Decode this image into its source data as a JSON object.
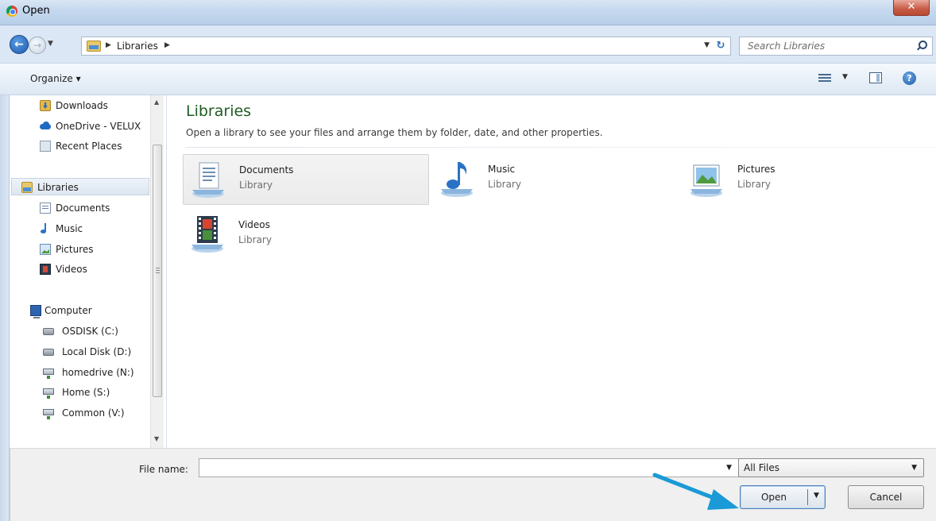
{
  "window": {
    "title": "Open"
  },
  "address": {
    "path_label": "Libraries",
    "search_placeholder": "Search Libraries"
  },
  "toolbar": {
    "organize_label": "Organize ▾"
  },
  "nav": {
    "items": [
      {
        "label": "Downloads",
        "icon": "downloads-icon"
      },
      {
        "label": "OneDrive - VELUX",
        "icon": "onedrive-icon"
      },
      {
        "label": "Recent Places",
        "icon": "recent-places-icon"
      },
      {
        "label": "Libraries",
        "icon": "library-icon",
        "selected": true
      },
      {
        "label": "Documents",
        "icon": "documents-icon"
      },
      {
        "label": "Music",
        "icon": "music-icon"
      },
      {
        "label": "Pictures",
        "icon": "pictures-icon"
      },
      {
        "label": "Videos",
        "icon": "videos-icon"
      },
      {
        "label": "Computer",
        "icon": "computer-icon"
      },
      {
        "label": "OSDISK (C:)",
        "icon": "disk-icon"
      },
      {
        "label": "Local Disk (D:)",
        "icon": "disk-icon"
      },
      {
        "label": "homedrive (N:)",
        "icon": "network-drive-icon"
      },
      {
        "label": "Home (S:)",
        "icon": "network-drive-icon"
      },
      {
        "label": "Common (V:)",
        "icon": "network-drive-icon"
      }
    ]
  },
  "content": {
    "title": "Libraries",
    "subtitle": "Open a library to see your files and arrange them by folder, date, and other properties.",
    "libraries": [
      {
        "name": "Documents",
        "type": "Library",
        "icon": "documents-library-icon",
        "selected": true
      },
      {
        "name": "Music",
        "type": "Library",
        "icon": "music-library-icon"
      },
      {
        "name": "Pictures",
        "type": "Library",
        "icon": "pictures-library-icon"
      },
      {
        "name": "Videos",
        "type": "Library",
        "icon": "videos-library-icon"
      }
    ]
  },
  "footer": {
    "file_name_label": "File name:",
    "file_name_value": "",
    "file_type": "All Files",
    "open_label": "Open",
    "cancel_label": "Cancel"
  },
  "colors": {
    "accent": "#1e5c24",
    "annotation_arrow": "#1a9ad6",
    "selection": "#4b7fb6"
  }
}
